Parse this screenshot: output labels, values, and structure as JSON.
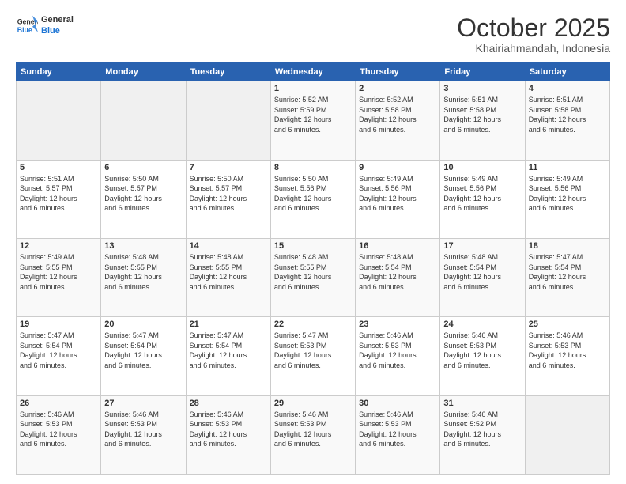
{
  "logo": {
    "line1": "General",
    "line2": "Blue"
  },
  "title": "October 2025",
  "subtitle": "Khairiahmandah, Indonesia",
  "weekdays": [
    "Sunday",
    "Monday",
    "Tuesday",
    "Wednesday",
    "Thursday",
    "Friday",
    "Saturday"
  ],
  "weeks": [
    [
      {
        "day": "",
        "info": ""
      },
      {
        "day": "",
        "info": ""
      },
      {
        "day": "",
        "info": ""
      },
      {
        "day": "1",
        "info": "Sunrise: 5:52 AM\nSunset: 5:59 PM\nDaylight: 12 hours\nand 6 minutes."
      },
      {
        "day": "2",
        "info": "Sunrise: 5:52 AM\nSunset: 5:58 PM\nDaylight: 12 hours\nand 6 minutes."
      },
      {
        "day": "3",
        "info": "Sunrise: 5:51 AM\nSunset: 5:58 PM\nDaylight: 12 hours\nand 6 minutes."
      },
      {
        "day": "4",
        "info": "Sunrise: 5:51 AM\nSunset: 5:58 PM\nDaylight: 12 hours\nand 6 minutes."
      }
    ],
    [
      {
        "day": "5",
        "info": "Sunrise: 5:51 AM\nSunset: 5:57 PM\nDaylight: 12 hours\nand 6 minutes."
      },
      {
        "day": "6",
        "info": "Sunrise: 5:50 AM\nSunset: 5:57 PM\nDaylight: 12 hours\nand 6 minutes."
      },
      {
        "day": "7",
        "info": "Sunrise: 5:50 AM\nSunset: 5:57 PM\nDaylight: 12 hours\nand 6 minutes."
      },
      {
        "day": "8",
        "info": "Sunrise: 5:50 AM\nSunset: 5:56 PM\nDaylight: 12 hours\nand 6 minutes."
      },
      {
        "day": "9",
        "info": "Sunrise: 5:49 AM\nSunset: 5:56 PM\nDaylight: 12 hours\nand 6 minutes."
      },
      {
        "day": "10",
        "info": "Sunrise: 5:49 AM\nSunset: 5:56 PM\nDaylight: 12 hours\nand 6 minutes."
      },
      {
        "day": "11",
        "info": "Sunrise: 5:49 AM\nSunset: 5:56 PM\nDaylight: 12 hours\nand 6 minutes."
      }
    ],
    [
      {
        "day": "12",
        "info": "Sunrise: 5:49 AM\nSunset: 5:55 PM\nDaylight: 12 hours\nand 6 minutes."
      },
      {
        "day": "13",
        "info": "Sunrise: 5:48 AM\nSunset: 5:55 PM\nDaylight: 12 hours\nand 6 minutes."
      },
      {
        "day": "14",
        "info": "Sunrise: 5:48 AM\nSunset: 5:55 PM\nDaylight: 12 hours\nand 6 minutes."
      },
      {
        "day": "15",
        "info": "Sunrise: 5:48 AM\nSunset: 5:55 PM\nDaylight: 12 hours\nand 6 minutes."
      },
      {
        "day": "16",
        "info": "Sunrise: 5:48 AM\nSunset: 5:54 PM\nDaylight: 12 hours\nand 6 minutes."
      },
      {
        "day": "17",
        "info": "Sunrise: 5:48 AM\nSunset: 5:54 PM\nDaylight: 12 hours\nand 6 minutes."
      },
      {
        "day": "18",
        "info": "Sunrise: 5:47 AM\nSunset: 5:54 PM\nDaylight: 12 hours\nand 6 minutes."
      }
    ],
    [
      {
        "day": "19",
        "info": "Sunrise: 5:47 AM\nSunset: 5:54 PM\nDaylight: 12 hours\nand 6 minutes."
      },
      {
        "day": "20",
        "info": "Sunrise: 5:47 AM\nSunset: 5:54 PM\nDaylight: 12 hours\nand 6 minutes."
      },
      {
        "day": "21",
        "info": "Sunrise: 5:47 AM\nSunset: 5:54 PM\nDaylight: 12 hours\nand 6 minutes."
      },
      {
        "day": "22",
        "info": "Sunrise: 5:47 AM\nSunset: 5:53 PM\nDaylight: 12 hours\nand 6 minutes."
      },
      {
        "day": "23",
        "info": "Sunrise: 5:46 AM\nSunset: 5:53 PM\nDaylight: 12 hours\nand 6 minutes."
      },
      {
        "day": "24",
        "info": "Sunrise: 5:46 AM\nSunset: 5:53 PM\nDaylight: 12 hours\nand 6 minutes."
      },
      {
        "day": "25",
        "info": "Sunrise: 5:46 AM\nSunset: 5:53 PM\nDaylight: 12 hours\nand 6 minutes."
      }
    ],
    [
      {
        "day": "26",
        "info": "Sunrise: 5:46 AM\nSunset: 5:53 PM\nDaylight: 12 hours\nand 6 minutes."
      },
      {
        "day": "27",
        "info": "Sunrise: 5:46 AM\nSunset: 5:53 PM\nDaylight: 12 hours\nand 6 minutes."
      },
      {
        "day": "28",
        "info": "Sunrise: 5:46 AM\nSunset: 5:53 PM\nDaylight: 12 hours\nand 6 minutes."
      },
      {
        "day": "29",
        "info": "Sunrise: 5:46 AM\nSunset: 5:53 PM\nDaylight: 12 hours\nand 6 minutes."
      },
      {
        "day": "30",
        "info": "Sunrise: 5:46 AM\nSunset: 5:53 PM\nDaylight: 12 hours\nand 6 minutes."
      },
      {
        "day": "31",
        "info": "Sunrise: 5:46 AM\nSunset: 5:52 PM\nDaylight: 12 hours\nand 6 minutes."
      },
      {
        "day": "",
        "info": ""
      }
    ]
  ]
}
